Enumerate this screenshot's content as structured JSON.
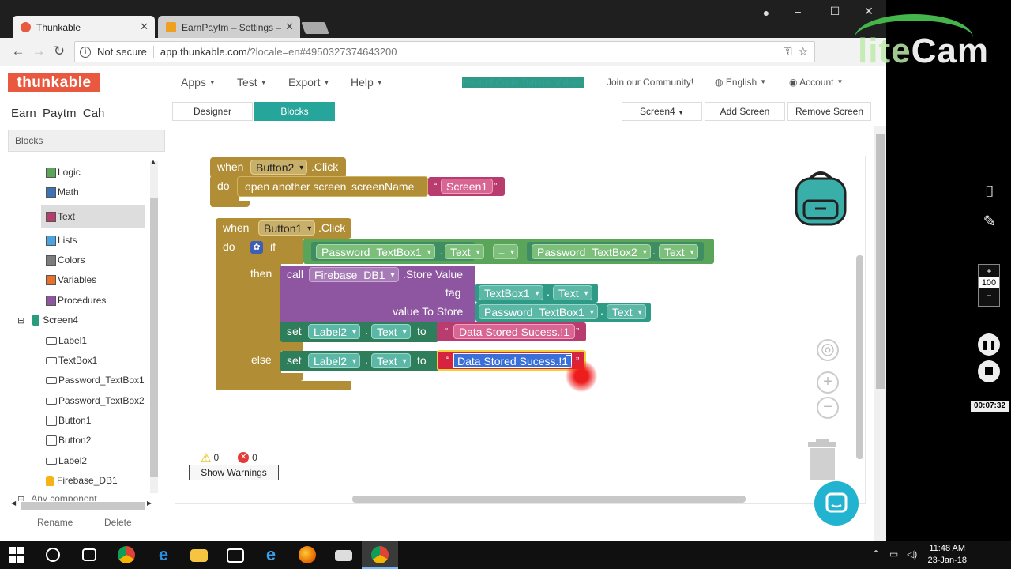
{
  "browser": {
    "tabs": [
      {
        "title": "Thunkable",
        "active": true
      },
      {
        "title": "EarnPaytm – Settings – F",
        "active": false
      }
    ],
    "address": {
      "security": "Not secure",
      "host": "app.thunkable.com",
      "path": "/?locale=en#4950327374643200"
    },
    "window_controls": [
      "–",
      "☐",
      "✕"
    ]
  },
  "appbar": {
    "logo": "thunkable",
    "menus": [
      "Apps",
      "Test",
      "Export",
      "Help"
    ],
    "links": {
      "tutorial": "Hour of Code Tutorial Videos",
      "community": "Join our Community!",
      "language": "English",
      "account": "Account"
    }
  },
  "subbar": {
    "project": "Earn_Paytm_Cah",
    "designer": "Designer",
    "blocks": "Blocks",
    "screen": "Screen4",
    "add_screen": "Add Screen",
    "remove_screen": "Remove Screen"
  },
  "panel": {
    "header": "Blocks",
    "builtins": [
      {
        "label": "Logic",
        "color": "#5ba55b"
      },
      {
        "label": "Math",
        "color": "#3f71b5"
      },
      {
        "label": "Text",
        "color": "#b83c6e"
      },
      {
        "label": "Lists",
        "color": "#4aa3df"
      },
      {
        "label": "Colors",
        "color": "#7d7d7d"
      },
      {
        "label": "Variables",
        "color": "#e8702a"
      },
      {
        "label": "Procedures",
        "color": "#8e56a0"
      }
    ],
    "screen": "Screen4",
    "components": [
      "Label1",
      "TextBox1",
      "Password_TextBox1",
      "Password_TextBox2",
      "Button1",
      "Button2",
      "Label2",
      "Firebase_DB1"
    ],
    "truncated": "Any component",
    "rename": "Rename",
    "delete": "Delete"
  },
  "workspace": {
    "block1": {
      "when": "when",
      "component": "Button2",
      "event": ".Click",
      "do": "do",
      "action": "open another screen",
      "param": "screenName",
      "value": "Screen1"
    },
    "block2": {
      "when": "when",
      "component": "Button1",
      "event": ".Click",
      "do": "do",
      "if": "if",
      "lhs": "Password_TextBox1",
      "lhs_prop": "Text",
      "op": "=",
      "rhs": "Password_TextBox2",
      "rhs_prop": "Text",
      "then": "then",
      "call": "call",
      "db": "Firebase_DB1",
      "method": ".Store Value",
      "tag_label": "tag",
      "tag_comp": "TextBox1",
      "tag_prop": "Text",
      "value_label": "value To Store",
      "value_comp": "Password_TextBox1",
      "value_prop": "Text",
      "set": "set",
      "label": "Label2",
      "label_prop": "Text",
      "to": "to",
      "then_text": "Data Stored Sucess.!1",
      "else": "else",
      "else_text": "Data Stored Sucess.!1"
    },
    "warnings": {
      "warn_count": "0",
      "error_count": "0",
      "button": "Show Warnings"
    }
  },
  "taskbar": {
    "time": "11:48 AM",
    "date": "23-Jan-18"
  },
  "recorder": {
    "zoom": "100",
    "elapsed": "00:07:32",
    "watermark_a": "lite",
    "watermark_b": "Cam"
  }
}
